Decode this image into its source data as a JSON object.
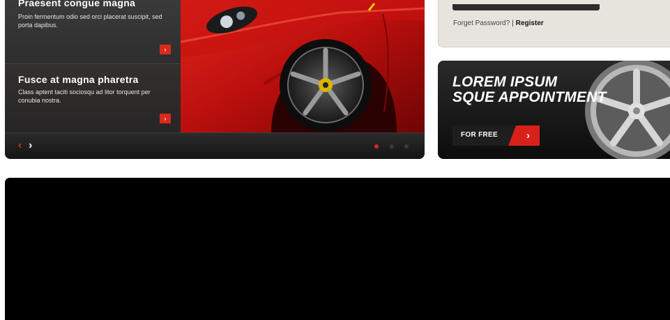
{
  "slider": {
    "captions": [
      {
        "title": "Praesent congue magna",
        "text": "Proin fermentum odio sed orci placerat suscipit, sed porta dapibus.",
        "more_icon": "chevron-right-icon"
      },
      {
        "title": "Fusce at magna pharetra",
        "text": "Class aptent taciti sociosqu ad litor torquent per conubia nostra.",
        "more_icon": "chevron-right-icon"
      }
    ],
    "controls": {
      "prev_glyph": "‹",
      "next_glyph": "›",
      "dot_count": 3,
      "active_dot": 1
    },
    "accent_color": "#d92a1c"
  },
  "login": {
    "forgot_label": "Forget Password?",
    "separator": "|",
    "register_label": "Register"
  },
  "promo": {
    "line1": "LOREM IPSUM",
    "line2": "SQUE APPOINTMENT",
    "cta_label": "FOR FREE",
    "cta_arrow": "›",
    "accent_color": "#d9211a"
  }
}
